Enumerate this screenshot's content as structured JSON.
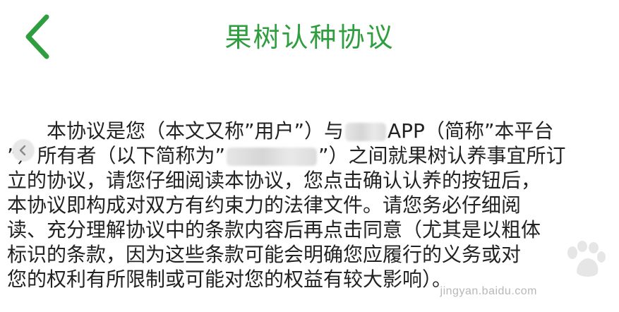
{
  "header": {
    "title": "果树认种协议",
    "back_icon": "chevron-left-icon",
    "accent_color": "#2f9e3f"
  },
  "agreement": {
    "line1_a": "本协议是您（本文又称”用户”）与",
    "line1_b": "APP（简称”本平台",
    "line2_a": "”）所有者（以下简称为”",
    "line2_b": "”）之间就果树认养事宜所订",
    "line3": "立的协议，请您仔细阅读本协议，您点击确认认养的按钮后，",
    "line4": "本协议即构成对双方有约束力的法律文件。请您务必仔细阅",
    "line5": "读、充分理解协议中的条款内容后再点击同意（尤其是以粗体",
    "line6": "标识的条款，因为这些条款可能会明确您应履行的义务或对",
    "line7": "您的权利有所限制或可能对您的权益有较大影响）。"
  },
  "watermark": {
    "text": "jingyan.baidu.com"
  }
}
